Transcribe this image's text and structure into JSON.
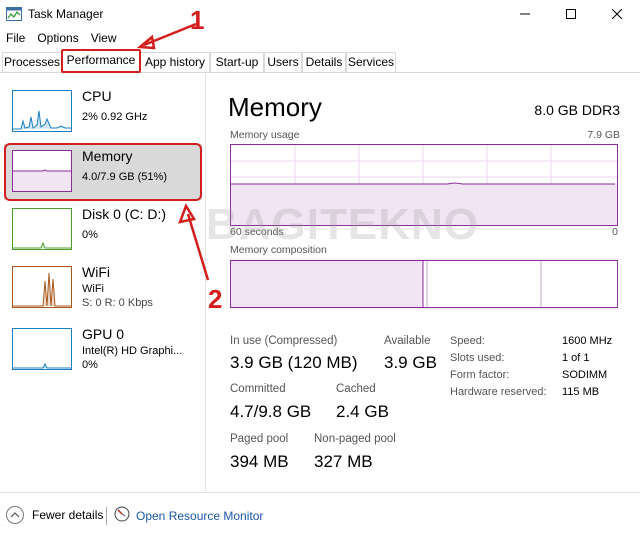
{
  "window": {
    "title": "Task Manager"
  },
  "menu": [
    "File",
    "Options",
    "View"
  ],
  "tabs": [
    "Processes",
    "Performance",
    "App history",
    "Start-up",
    "Users",
    "Details",
    "Services"
  ],
  "active_tab": "Performance",
  "sidebar": {
    "items": [
      {
        "name": "CPU",
        "line1": "2% 0.92 GHz",
        "line2": "",
        "color": "#1a7fc1"
      },
      {
        "name": "Memory",
        "line1": "4.0/7.9 GB (51%)",
        "line2": "",
        "color": "#8b2d9a",
        "selected": true
      },
      {
        "name": "Disk 0 (C: D:)",
        "line1": "0%",
        "line2": "",
        "color": "#4c9f2f"
      },
      {
        "name": "WiFi",
        "line1": "WiFi",
        "line2": "S: 0 R: 0 Kbps",
        "color": "#a8581d"
      },
      {
        "name": "GPU 0",
        "line1": "Intel(R) HD Graphi...",
        "line2": "0%",
        "color": "#1a7fc1"
      }
    ]
  },
  "main": {
    "title": "Memory",
    "spec": "8.0 GB DDR3",
    "usage_label": "Memory usage",
    "usage_max": "7.9 GB",
    "time_left": "60 seconds",
    "time_right": "0",
    "composition_label": "Memory composition",
    "usage_fraction": 0.51,
    "stats": {
      "in_use_label": "In use (Compressed)",
      "in_use_value": "3.9 GB (120 MB)",
      "available_label": "Available",
      "available_value": "3.9 GB",
      "committed_label": "Committed",
      "committed_value": "4.7/9.8 GB",
      "cached_label": "Cached",
      "cached_value": "2.4 GB",
      "paged_label": "Paged pool",
      "paged_value": "394 MB",
      "nonpaged_label": "Non-paged pool",
      "nonpaged_value": "327 MB"
    },
    "details": [
      {
        "label": "Speed:",
        "value": "1600 MHz"
      },
      {
        "label": "Slots used:",
        "value": "1 of 1"
      },
      {
        "label": "Form factor:",
        "value": "SODIMM"
      },
      {
        "label": "Hardware reserved:",
        "value": "115 MB"
      }
    ]
  },
  "footer": {
    "fewer_details": "Fewer details",
    "resource_monitor": "Open Resource Monitor"
  },
  "annotations": {
    "one": "1",
    "two": "2"
  },
  "watermark": "BAGITEKNO",
  "accent": "#8b2d9a",
  "annotation_color": "#d31e1e"
}
